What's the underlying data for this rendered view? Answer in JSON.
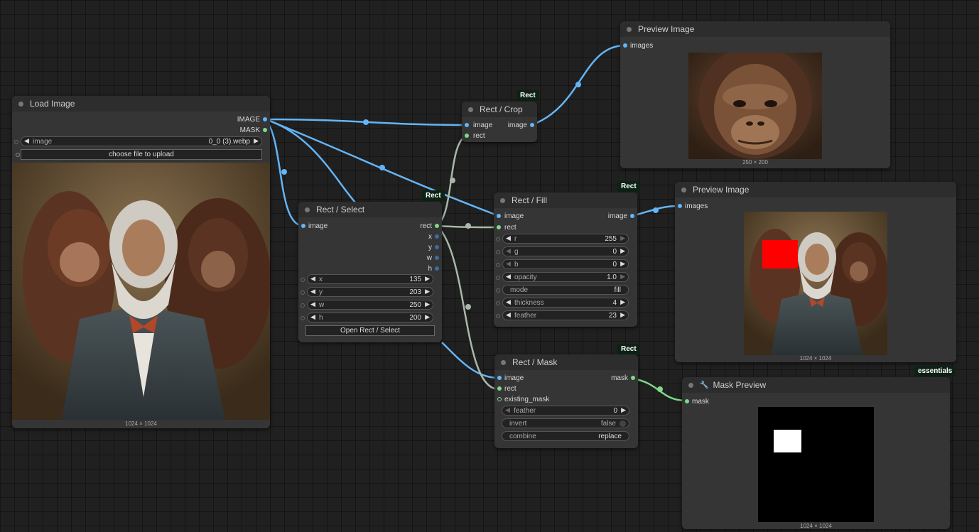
{
  "nodes": {
    "load_image": {
      "title": "Load Image",
      "out_image": "IMAGE",
      "out_mask": "MASK",
      "image_label": "image",
      "image_value": "0_0 (3).webp",
      "upload_button": "choose file to upload",
      "size": "1024 × 1024"
    },
    "rect_select": {
      "badge": "Rect",
      "title": "Rect / Select",
      "in_image": "image",
      "out_rect": "rect",
      "out_x": "x",
      "out_y": "y",
      "out_w": "w",
      "out_h": "h",
      "x_label": "x",
      "x_value": "135",
      "y_label": "y",
      "y_value": "203",
      "w_label": "w",
      "w_value": "250",
      "h_label": "h",
      "h_value": "200",
      "open_button": "Open Rect / Select"
    },
    "rect_crop": {
      "badge": "Rect",
      "title": "Rect / Crop",
      "in_image": "image",
      "in_rect": "rect",
      "out_image": "image"
    },
    "rect_fill": {
      "badge": "Rect",
      "title": "Rect / Fill",
      "in_image": "image",
      "in_rect": "rect",
      "out_image": "image",
      "r_label": "r",
      "r_value": "255",
      "g_label": "g",
      "g_value": "0",
      "b_label": "b",
      "b_value": "0",
      "opacity_label": "opacity",
      "opacity_value": "1.0",
      "mode_label": "mode",
      "mode_value": "fill",
      "thickness_label": "thickness",
      "thickness_value": "4",
      "feather_label": "feather",
      "feather_value": "23"
    },
    "rect_mask": {
      "badge": "Rect",
      "title": "Rect / Mask",
      "in_image": "image",
      "in_rect": "rect",
      "in_existing_mask": "existing_mask",
      "out_mask": "mask",
      "feather_label": "feather",
      "feather_value": "0",
      "invert_label": "invert",
      "invert_value": "false",
      "combine_label": "combine",
      "combine_value": "replace"
    },
    "preview1": {
      "title": "Preview Image",
      "in_images": "images",
      "size": "250 × 200"
    },
    "preview2": {
      "title": "Preview Image",
      "in_images": "images",
      "size": "1024 × 1024"
    },
    "mask_preview": {
      "badge": "essentials",
      "title": "Mask Preview",
      "in_mask": "mask",
      "size": "1024 × 1024"
    }
  },
  "colors": {
    "image_wire": "#64b5f6",
    "rect_wire": "#a9b8a9",
    "mask_wire": "#7ed98a",
    "fill_color": "#ff0000"
  }
}
